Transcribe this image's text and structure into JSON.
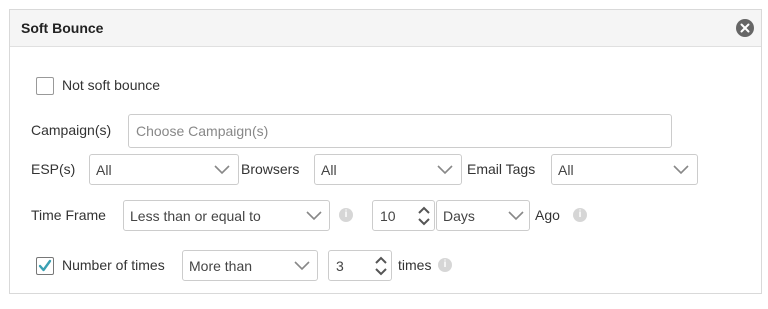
{
  "panel": {
    "title": "Soft Bounce"
  },
  "not_soft_bounce": {
    "label": "Not soft bounce",
    "checked": false
  },
  "campaign": {
    "label": "Campaign(s)",
    "placeholder": "Choose Campaign(s)"
  },
  "esp": {
    "label": "ESP(s)",
    "value": "All"
  },
  "browsers": {
    "label": "Browsers",
    "value": "All"
  },
  "email_tags": {
    "label": "Email Tags",
    "value": "All"
  },
  "time_frame": {
    "label": "Time Frame",
    "operator": "Less than or equal to",
    "amount": "10",
    "unit": "Days",
    "suffix": "Ago"
  },
  "number_of_times": {
    "label": "Number of times",
    "checked": true,
    "operator": "More than",
    "amount": "3",
    "suffix": "times"
  },
  "colors": {
    "check": "#3aa0b3",
    "info": "#d6d6d6",
    "close_bg": "#666666"
  }
}
